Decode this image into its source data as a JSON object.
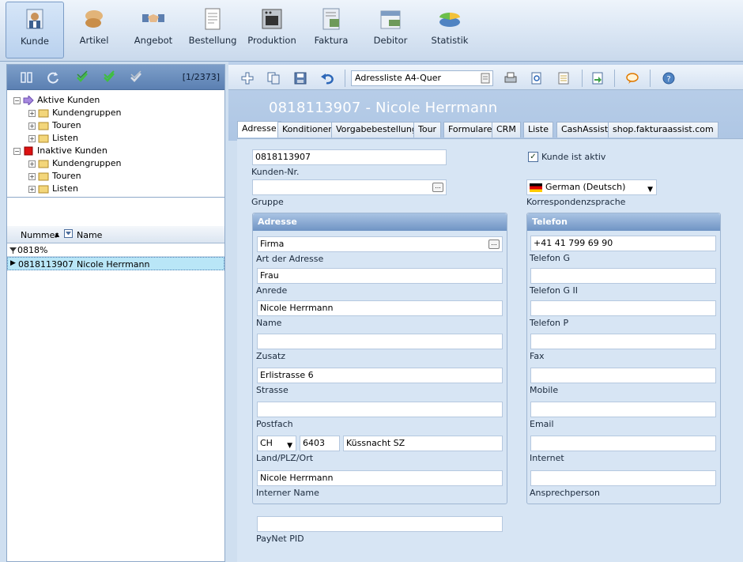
{
  "ribbon": {
    "items": [
      {
        "label": "Kunde",
        "icon": "customer-icon"
      },
      {
        "label": "Artikel",
        "icon": "article-icon"
      },
      {
        "label": "Angebot",
        "icon": "handshake-icon"
      },
      {
        "label": "Bestellung",
        "icon": "document-icon"
      },
      {
        "label": "Produktion",
        "icon": "oven-icon"
      },
      {
        "label": "Faktura",
        "icon": "invoice-icon"
      },
      {
        "label": "Debitor",
        "icon": "calendar-icon"
      },
      {
        "label": "Statistik",
        "icon": "pie-chart-icon"
      }
    ]
  },
  "left": {
    "record_count": "[1/2373]",
    "tree": {
      "active": "Aktive Kunden",
      "inactive": "Inaktive Kunden",
      "children": [
        "Kundengruppen",
        "Touren",
        "Listen"
      ]
    },
    "grid": {
      "col_number": "Nummer",
      "col_name": "Name",
      "filter": "0818%",
      "rows": [
        {
          "number": "0818113907",
          "name": "Nicole Herrmann"
        }
      ]
    }
  },
  "toolbar": {
    "report": "Adressliste A4-Quer"
  },
  "customer": {
    "title": "0818113907 - Nicole Herrmann"
  },
  "tabs": [
    "Adresse",
    "Konditionen",
    "Vorgabebestellung",
    "Tour",
    "Formulare",
    "CRM",
    "Liste",
    "CashAssist",
    "shop.fakturaassist.com"
  ],
  "form": {
    "kunden_nr": {
      "value": "0818113907",
      "label": "Kunden-Nr."
    },
    "gruppe": {
      "value": "",
      "label": "Gruppe"
    },
    "aktiv": {
      "label": "Kunde ist aktiv",
      "checked": "✓"
    },
    "sprache": {
      "value": "German (Deutsch)",
      "label": "Korrespondenzsprache"
    },
    "adresse_title": "Adresse",
    "telefon_title": "Telefon",
    "adresse": {
      "art": {
        "value": "Firma",
        "label": "Art der Adresse"
      },
      "anrede": {
        "value": "Frau",
        "label": "Anrede"
      },
      "name": {
        "value": "Nicole Herrmann",
        "label": "Name"
      },
      "zusatz": {
        "value": "",
        "label": "Zusatz"
      },
      "strasse": {
        "value": "Erlistrasse 6",
        "label": "Strasse"
      },
      "postfach": {
        "value": "",
        "label": "Postfach"
      },
      "land": "CH",
      "plz": "6403",
      "ort": "Küssnacht SZ",
      "land_label": "Land/PLZ/Ort",
      "interner_name": {
        "value": "Nicole Herrmann",
        "label": "Interner Name"
      }
    },
    "telefon": {
      "g": {
        "value": "+41 41 799 69 90",
        "label": "Telefon G"
      },
      "g2": {
        "value": "",
        "label": "Telefon G II"
      },
      "p": {
        "value": "",
        "label": "Telefon P"
      },
      "fax": {
        "value": "",
        "label": "Fax"
      },
      "mobile": {
        "value": "",
        "label": "Mobile"
      },
      "email": {
        "value": "",
        "label": "Email"
      },
      "internet": {
        "value": "",
        "label": "Internet"
      },
      "ansprech": {
        "value": "",
        "label": "Ansprechperson"
      }
    },
    "paynet": {
      "value": "",
      "label": "PayNet PID"
    }
  }
}
